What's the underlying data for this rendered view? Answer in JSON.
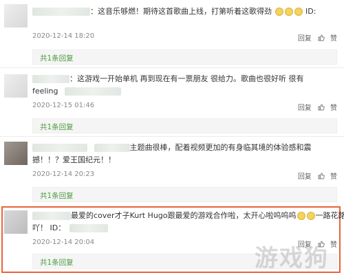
{
  "comments": [
    {
      "text1": "：这音乐够燃！期待这首歌曲上线，打第听着这歌得劲",
      "text1_tail": "ID:",
      "timestamp": "2020-12-14 18:20",
      "reply_label": "回复",
      "like_label": "赞",
      "replies_link": "共1条回复"
    },
    {
      "text1": "：这游戏一开始单机 再到现在有一票朋友 很给力。歌曲也很好听 很有",
      "text2": "feeling",
      "timestamp": "2020-12-15 01:46",
      "reply_label": "回复",
      "like_label": "赞",
      "replies_link": "共1条回复"
    },
    {
      "text1": "主题曲很棒，配着视频更加的有身临其境的体验感和震",
      "text2": "撼！！？爱王国纪元！！",
      "timestamp": "2020-12-14 20:23",
      "reply_label": "回复",
      "like_label": "赞",
      "replies_link": "共1条回复"
    },
    {
      "text1": "最爱的cover才子Kurt Hugo跟最爱的游戏合作啦，太开心啦呜呜呜",
      "text1_tail": "一路花路",
      "text2": "吖！ ID：",
      "timestamp": "2020-12-14 20:04",
      "reply_label": "回复",
      "like_label": "赞",
      "replies_link": "共1条回复"
    }
  ],
  "watermark": "游戏狗",
  "colors": {
    "highlight_border": "#e8633a",
    "reply_link": "#4c9a3e"
  }
}
